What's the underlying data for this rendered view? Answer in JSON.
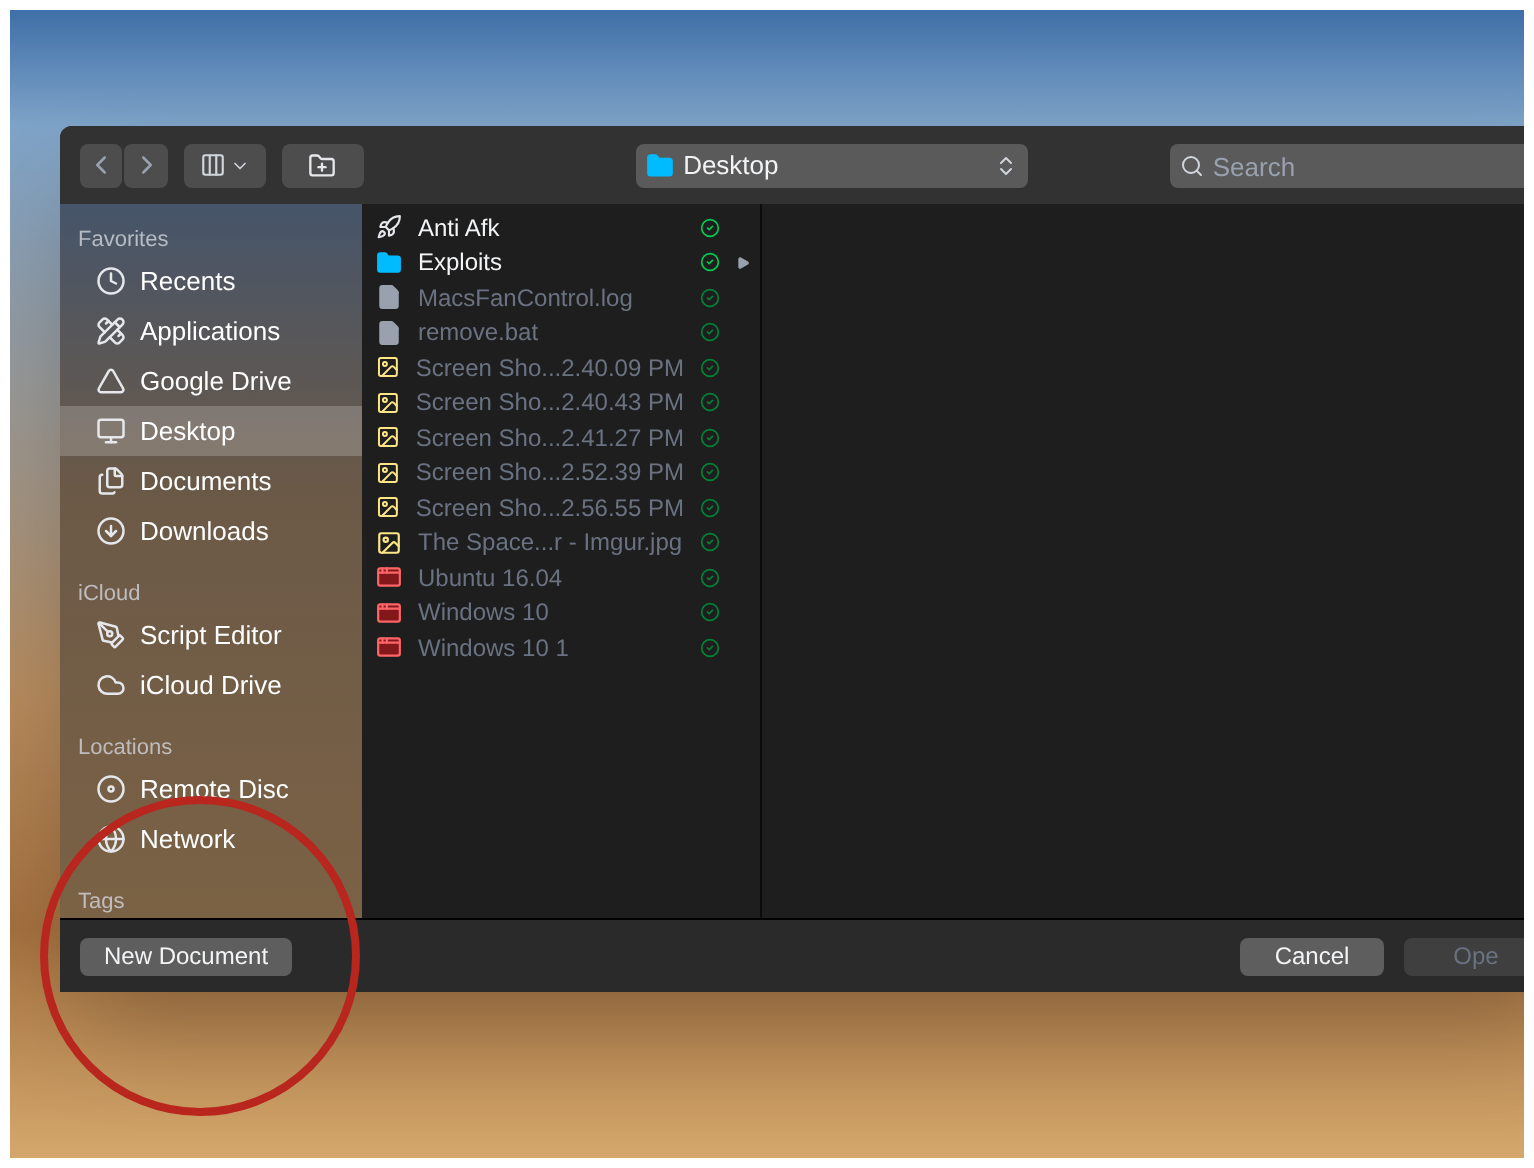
{
  "toolbar": {
    "location": "Desktop",
    "search": {
      "placeholder": "Search"
    }
  },
  "sidebar": [
    {
      "heading": "Favorites",
      "items": [
        {
          "label": "Recents",
          "selected": false
        },
        {
          "label": "Applications",
          "selected": false
        },
        {
          "label": "Google Drive",
          "selected": false
        },
        {
          "label": "Desktop",
          "selected": true
        },
        {
          "label": "Documents",
          "selected": false
        },
        {
          "label": "Downloads",
          "selected": false
        }
      ]
    },
    {
      "heading": "iCloud",
      "items": [
        {
          "label": "Script Editor",
          "selected": false
        },
        {
          "label": "iCloud Drive",
          "selected": false
        }
      ]
    },
    {
      "heading": "Locations",
      "items": [
        {
          "label": "Remote Disc",
          "selected": false
        },
        {
          "label": "Network",
          "selected": false
        }
      ]
    },
    {
      "heading": "Tags"
    }
  ],
  "files": [
    {
      "name": "Anti Afk",
      "kind": "app",
      "disabled": false,
      "expandable": false
    },
    {
      "name": "Exploits",
      "kind": "folder",
      "disabled": false,
      "expandable": true
    },
    {
      "name": "MacsFanControl.log",
      "kind": "document",
      "disabled": true,
      "expandable": false
    },
    {
      "name": "remove.bat",
      "kind": "document",
      "disabled": true,
      "expandable": false
    },
    {
      "name": "Screen Sho...2.40.09 PM",
      "kind": "image",
      "disabled": true,
      "expandable": false
    },
    {
      "name": "Screen Sho...2.40.43 PM",
      "kind": "image",
      "disabled": true,
      "expandable": false
    },
    {
      "name": "Screen Sho...2.41.27 PM",
      "kind": "image",
      "disabled": true,
      "expandable": false
    },
    {
      "name": "Screen Sho...2.52.39 PM",
      "kind": "image",
      "disabled": true,
      "expandable": false
    },
    {
      "name": "Screen Sho...2.56.55 PM",
      "kind": "image",
      "disabled": true,
      "expandable": false
    },
    {
      "name": "The Space...r - Imgur.jpg",
      "kind": "image",
      "disabled": true,
      "expandable": false
    },
    {
      "name": "Ubuntu 16.04",
      "kind": "vm",
      "disabled": true,
      "expandable": false
    },
    {
      "name": "Windows 10",
      "kind": "vm",
      "disabled": true,
      "expandable": false
    },
    {
      "name": "Windows 10 1",
      "kind": "vm",
      "disabled": true,
      "expandable": false
    }
  ],
  "footer": {
    "new_button": "New Document",
    "buttons": [
      {
        "label": "Cancel",
        "disabled": false
      },
      {
        "label": "Ope",
        "disabled": true
      }
    ]
  }
}
